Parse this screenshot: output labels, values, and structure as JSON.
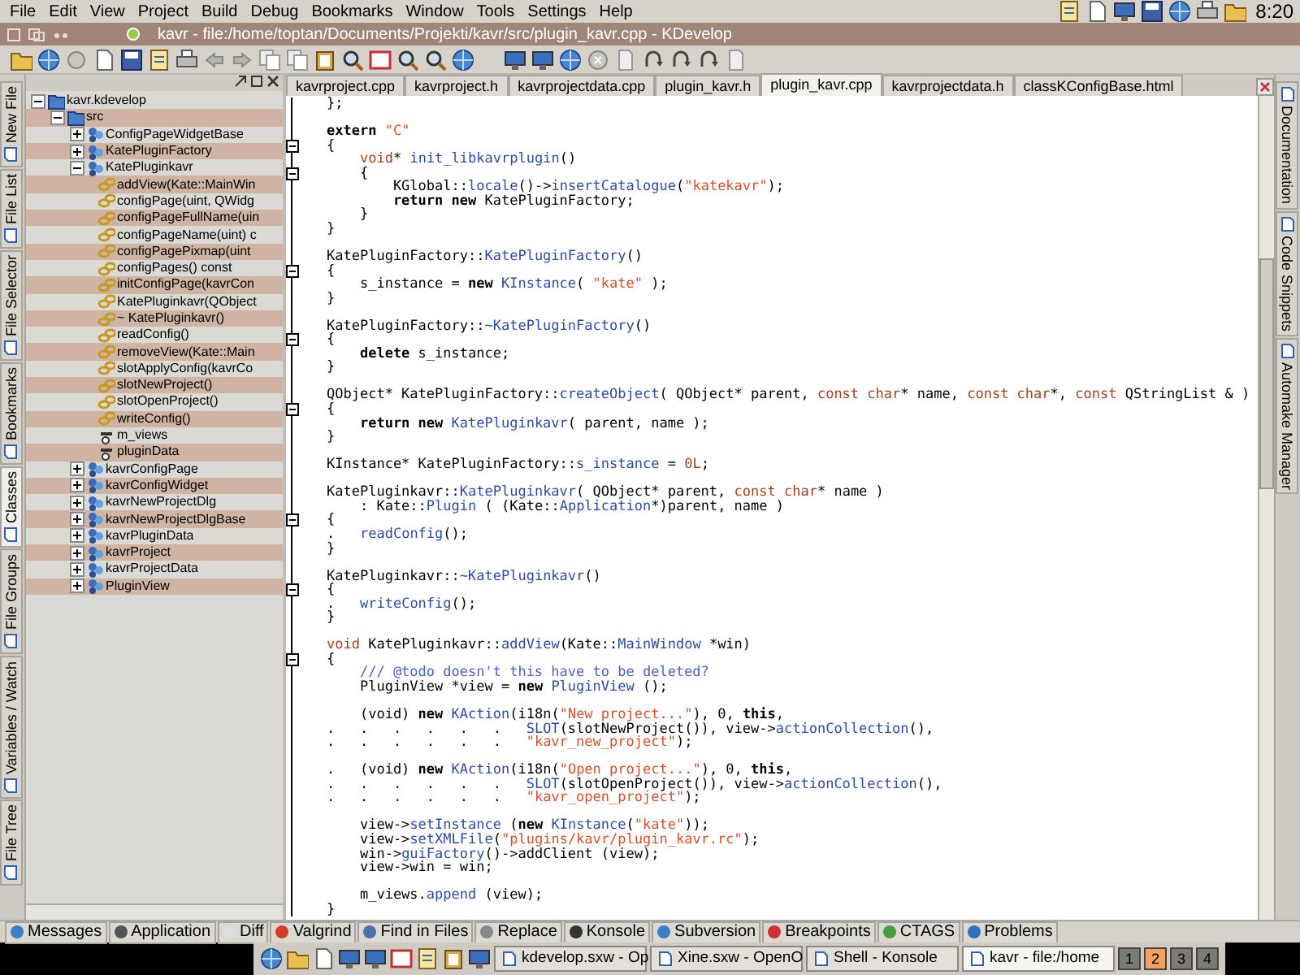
{
  "menu_bar": {
    "items": [
      "File",
      "Edit",
      "View",
      "Project",
      "Build",
      "Debug",
      "Bookmarks",
      "Window",
      "Tools",
      "Settings",
      "Help"
    ],
    "clock": "8:20"
  },
  "window": {
    "title": "kavr - file:/home/toptan/Documents/Projekti/kavr/src/plugin_kavr.cpp - KDevelop"
  },
  "left_tabs": [
    {
      "label": "New File",
      "selected": false
    },
    {
      "label": "File List",
      "selected": false
    },
    {
      "label": "File Selector",
      "selected": false
    },
    {
      "label": "Bookmarks",
      "selected": false
    },
    {
      "label": "Classes",
      "selected": true
    },
    {
      "label": "File Groups",
      "selected": false
    },
    {
      "label": "Variables / Watch",
      "selected": false
    },
    {
      "label": "File Tree",
      "selected": false
    }
  ],
  "class_tree": {
    "nodes": [
      {
        "label": "kavr.kdevelop",
        "kind": "project",
        "expanded": true,
        "children": [
          {
            "label": "src",
            "kind": "folder",
            "expanded": true,
            "children": [
              {
                "label": "ConfigPageWidgetBase",
                "kind": "class",
                "expanded": false
              },
              {
                "label": "KatePluginFactory",
                "kind": "class",
                "expanded": false
              },
              {
                "label": "KatePluginkavr",
                "kind": "class",
                "expanded": true,
                "children": [
                  {
                    "label": "addView(Kate::MainWin",
                    "kind": "method"
                  },
                  {
                    "label": "configPage(uint, QWidg",
                    "kind": "method"
                  },
                  {
                    "label": "configPageFullName(uin",
                    "kind": "method"
                  },
                  {
                    "label": "configPageName(uint) c",
                    "kind": "method"
                  },
                  {
                    "label": "configPagePixmap(uint",
                    "kind": "method"
                  },
                  {
                    "label": "configPages() const",
                    "kind": "method"
                  },
                  {
                    "label": "initConfigPage(kavrCon",
                    "kind": "method"
                  },
                  {
                    "label": "KatePluginkavr(QObject",
                    "kind": "method"
                  },
                  {
                    "label": "~ KatePluginkavr()",
                    "kind": "method"
                  },
                  {
                    "label": "readConfig()",
                    "kind": "method"
                  },
                  {
                    "label": "removeView(Kate::Main",
                    "kind": "method"
                  },
                  {
                    "label": "slotApplyConfig(kavrCo",
                    "kind": "method"
                  },
                  {
                    "label": "slotNewProject()",
                    "kind": "method"
                  },
                  {
                    "label": "slotOpenProject()",
                    "kind": "method"
                  },
                  {
                    "label": "writeConfig()",
                    "kind": "method"
                  },
                  {
                    "label": "m_views",
                    "kind": "attribute"
                  },
                  {
                    "label": "pluginData",
                    "kind": "attribute"
                  }
                ]
              },
              {
                "label": "kavrConfigPage",
                "kind": "class",
                "expanded": false
              },
              {
                "label": "kavrConfigWidget",
                "kind": "class",
                "expanded": false
              },
              {
                "label": "kavrNewProjectDlg",
                "kind": "class",
                "expanded": false
              },
              {
                "label": "kavrNewProjectDlgBase",
                "kind": "class",
                "expanded": false
              },
              {
                "label": "kavrPluginData",
                "kind": "class",
                "expanded": false
              },
              {
                "label": "kavrProject",
                "kind": "class",
                "expanded": false
              },
              {
                "label": "kavrProjectData",
                "kind": "class",
                "expanded": false
              },
              {
                "label": "PluginView",
                "kind": "class",
                "expanded": false
              }
            ]
          }
        ]
      }
    ]
  },
  "editor_tabs": [
    {
      "label": "kavrproject.cpp",
      "selected": false
    },
    {
      "label": "kavrproject.h",
      "selected": false
    },
    {
      "label": "kavrprojectdata.cpp",
      "selected": false
    },
    {
      "label": "plugin_kavr.h",
      "selected": false
    },
    {
      "label": "plugin_kavr.cpp",
      "selected": true
    },
    {
      "label": "kavrprojectdata.h",
      "selected": false
    },
    {
      "label": "classKConfigBase.html",
      "selected": false
    }
  ],
  "code": {
    "lines": [
      {
        "fold": false,
        "segments": [
          {
            "kind": "plain",
            "text": "};"
          }
        ]
      },
      {
        "fold": false
      },
      {
        "fold": false,
        "segments": [
          {
            "kind": "keyword",
            "text": "extern "
          },
          {
            "kind": "string",
            "text": "\"C\""
          }
        ]
      },
      {
        "fold": true,
        "segments": [
          {
            "kind": "plain",
            "text": "{"
          }
        ]
      },
      {
        "fold": false,
        "segments": [
          {
            "kind": "type",
            "text": "    void"
          },
          {
            "kind": "plain",
            "text": "* "
          },
          {
            "kind": "function",
            "text": "init_libkavrplugin"
          },
          {
            "kind": "plain",
            "text": "()"
          }
        ]
      },
      {
        "fold": true,
        "segments": [
          {
            "kind": "plain",
            "text": "    {"
          }
        ]
      },
      {
        "fold": false,
        "segments": [
          {
            "kind": "plain",
            "text": "        KGlobal::"
          },
          {
            "kind": "function",
            "text": "locale"
          },
          {
            "kind": "plain",
            "text": "()->"
          },
          {
            "kind": "function",
            "text": "insertCatalogue"
          },
          {
            "kind": "plain",
            "text": "("
          },
          {
            "kind": "string",
            "text": "\"katekavr\""
          },
          {
            "kind": "plain",
            "text": ");"
          }
        ]
      },
      {
        "fold": false,
        "segments": [
          {
            "kind": "keyword",
            "text": "        return new"
          },
          {
            "kind": "plain",
            "text": " KatePluginFactory;"
          }
        ]
      },
      {
        "fold": false,
        "segments": [
          {
            "kind": "plain",
            "text": "    }"
          }
        ]
      },
      {
        "fold": false,
        "segments": [
          {
            "kind": "plain",
            "text": "}"
          }
        ]
      },
      {
        "fold": false
      },
      {
        "fold": false,
        "segments": [
          {
            "kind": "plain",
            "text": "KatePluginFactory::"
          },
          {
            "kind": "function",
            "text": "KatePluginFactory"
          },
          {
            "kind": "plain",
            "text": "()"
          }
        ]
      },
      {
        "fold": true,
        "segments": [
          {
            "kind": "plain",
            "text": "{"
          }
        ]
      },
      {
        "fold": false,
        "segments": [
          {
            "kind": "plain",
            "text": "    s_instance = "
          },
          {
            "kind": "keyword",
            "text": "new "
          },
          {
            "kind": "function",
            "text": "KInstance"
          },
          {
            "kind": "plain",
            "text": "( "
          },
          {
            "kind": "string",
            "text": "\"kate\""
          },
          {
            "kind": "plain",
            "text": " );"
          }
        ]
      },
      {
        "fold": false,
        "segments": [
          {
            "kind": "plain",
            "text": "}"
          }
        ]
      },
      {
        "fold": false
      },
      {
        "fold": false,
        "segments": [
          {
            "kind": "plain",
            "text": "KatePluginFactory::"
          },
          {
            "kind": "function",
            "text": "~KatePluginFactory"
          },
          {
            "kind": "plain",
            "text": "()"
          }
        ]
      },
      {
        "fold": true,
        "segments": [
          {
            "kind": "plain",
            "text": "{"
          }
        ]
      },
      {
        "fold": false,
        "segments": [
          {
            "kind": "keyword",
            "text": "    delete"
          },
          {
            "kind": "plain",
            "text": " s_instance;"
          }
        ]
      },
      {
        "fold": false,
        "segments": [
          {
            "kind": "plain",
            "text": "}"
          }
        ]
      },
      {
        "fold": false
      },
      {
        "fold": false,
        "segments": [
          {
            "kind": "plain",
            "text": "QObject* KatePluginFactory::"
          },
          {
            "kind": "function",
            "text": "createObject"
          },
          {
            "kind": "plain",
            "text": "( QObject* parent, "
          },
          {
            "kind": "type",
            "text": "const char"
          },
          {
            "kind": "plain",
            "text": "* name, "
          },
          {
            "kind": "type",
            "text": "const char"
          },
          {
            "kind": "plain",
            "text": "*, "
          },
          {
            "kind": "type",
            "text": "const"
          },
          {
            "kind": "plain",
            "text": " QStringList & )"
          }
        ]
      },
      {
        "fold": true,
        "segments": [
          {
            "kind": "plain",
            "text": "{"
          }
        ]
      },
      {
        "fold": false,
        "segments": [
          {
            "kind": "keyword",
            "text": "    return new "
          },
          {
            "kind": "function",
            "text": "KatePluginkavr"
          },
          {
            "kind": "plain",
            "text": "( parent, name );"
          }
        ]
      },
      {
        "fold": false,
        "segments": [
          {
            "kind": "plain",
            "text": "}"
          }
        ]
      },
      {
        "fold": false
      },
      {
        "fold": false,
        "segments": [
          {
            "kind": "plain",
            "text": "KInstance* KatePluginFactory::"
          },
          {
            "kind": "function",
            "text": "s_instance"
          },
          {
            "kind": "plain",
            "text": " = "
          },
          {
            "kind": "type",
            "text": "0L"
          },
          {
            "kind": "plain",
            "text": ";"
          }
        ]
      },
      {
        "fold": false
      },
      {
        "fold": false,
        "segments": [
          {
            "kind": "plain",
            "text": "KatePluginkavr::"
          },
          {
            "kind": "function",
            "text": "KatePluginkavr"
          },
          {
            "kind": "plain",
            "text": "( QObject* parent, "
          },
          {
            "kind": "type",
            "text": "const char"
          },
          {
            "kind": "plain",
            "text": "* name )"
          }
        ]
      },
      {
        "fold": false,
        "segments": [
          {
            "kind": "plain",
            "text": "    : Kate::"
          },
          {
            "kind": "function",
            "text": "Plugin"
          },
          {
            "kind": "plain",
            "text": " ( (Kate::"
          },
          {
            "kind": "function",
            "text": "Application"
          },
          {
            "kind": "plain",
            "text": "*)parent, name )"
          }
        ]
      },
      {
        "fold": true,
        "segments": [
          {
            "kind": "plain",
            "text": "{"
          }
        ]
      },
      {
        "fold": false,
        "segments": [
          {
            "kind": "plain",
            "text": ".   "
          },
          {
            "kind": "function",
            "text": "readConfig"
          },
          {
            "kind": "plain",
            "text": "();"
          }
        ]
      },
      {
        "fold": false,
        "segments": [
          {
            "kind": "plain",
            "text": "}"
          }
        ]
      },
      {
        "fold": false
      },
      {
        "fold": false,
        "segments": [
          {
            "kind": "plain",
            "text": "KatePluginkavr::"
          },
          {
            "kind": "function",
            "text": "~KatePluginkavr"
          },
          {
            "kind": "plain",
            "text": "()"
          }
        ]
      },
      {
        "fold": true,
        "segments": [
          {
            "kind": "plain",
            "text": "{"
          }
        ]
      },
      {
        "fold": false,
        "segments": [
          {
            "kind": "plain",
            "text": ".   "
          },
          {
            "kind": "function",
            "text": "writeConfig"
          },
          {
            "kind": "plain",
            "text": "();"
          }
        ]
      },
      {
        "fold": false,
        "segments": [
          {
            "kind": "plain",
            "text": "}"
          }
        ]
      },
      {
        "fold": false
      },
      {
        "fold": false,
        "segments": [
          {
            "kind": "type",
            "text": "void"
          },
          {
            "kind": "plain",
            "text": " KatePluginkavr::"
          },
          {
            "kind": "function",
            "text": "addView"
          },
          {
            "kind": "plain",
            "text": "(Kate::"
          },
          {
            "kind": "function",
            "text": "MainWindow"
          },
          {
            "kind": "plain",
            "text": " *win)"
          }
        ]
      },
      {
        "fold": true,
        "segments": [
          {
            "kind": "plain",
            "text": "{"
          }
        ]
      },
      {
        "fold": false,
        "segments": [
          {
            "kind": "comment",
            "text": "    /// @todo doesn't this have to be deleted?"
          }
        ]
      },
      {
        "fold": false,
        "segments": [
          {
            "kind": "plain",
            "text": "    PluginView *view = "
          },
          {
            "kind": "keyword",
            "text": "new "
          },
          {
            "kind": "function",
            "text": "PluginView"
          },
          {
            "kind": "plain",
            "text": " ();"
          }
        ]
      },
      {
        "fold": false
      },
      {
        "fold": false,
        "segments": [
          {
            "kind": "plain",
            "text": "    (void) "
          },
          {
            "kind": "keyword",
            "text": "new "
          },
          {
            "kind": "function",
            "text": "KAction"
          },
          {
            "kind": "plain",
            "text": "(i18n("
          },
          {
            "kind": "string",
            "text": "\"New project...\""
          },
          {
            "kind": "plain",
            "text": "), 0, "
          },
          {
            "kind": "keyword",
            "text": "this"
          },
          {
            "kind": "plain",
            "text": ","
          }
        ]
      },
      {
        "fold": false,
        "segments": [
          {
            "kind": "plain",
            "text": ".   .   .   .   .   .   "
          },
          {
            "kind": "function",
            "text": "SLOT"
          },
          {
            "kind": "plain",
            "text": "(slotNewProject()), view->"
          },
          {
            "kind": "function",
            "text": "actionCollection"
          },
          {
            "kind": "plain",
            "text": "(),"
          }
        ]
      },
      {
        "fold": false,
        "segments": [
          {
            "kind": "plain",
            "text": ".   .   .   .   .   .   "
          },
          {
            "kind": "string",
            "text": "\"kavr_new_project\""
          },
          {
            "kind": "plain",
            "text": ");"
          }
        ]
      },
      {
        "fold": false
      },
      {
        "fold": false,
        "segments": [
          {
            "kind": "plain",
            "text": ".   (void) "
          },
          {
            "kind": "keyword",
            "text": "new "
          },
          {
            "kind": "function",
            "text": "KAction"
          },
          {
            "kind": "plain",
            "text": "(i18n("
          },
          {
            "kind": "string",
            "text": "\"Open project...\""
          },
          {
            "kind": "plain",
            "text": "), 0, "
          },
          {
            "kind": "keyword",
            "text": "this"
          },
          {
            "kind": "plain",
            "text": ","
          }
        ]
      },
      {
        "fold": false,
        "segments": [
          {
            "kind": "plain",
            "text": ".   .   .   .   .   .   "
          },
          {
            "kind": "function",
            "text": "SLOT"
          },
          {
            "kind": "plain",
            "text": "(slotOpenProject()), view->"
          },
          {
            "kind": "function",
            "text": "actionCollection"
          },
          {
            "kind": "plain",
            "text": "(),"
          }
        ]
      },
      {
        "fold": false,
        "segments": [
          {
            "kind": "plain",
            "text": ".   .   .   .   .   .   "
          },
          {
            "kind": "string",
            "text": "\"kavr_open_project\""
          },
          {
            "kind": "plain",
            "text": ");"
          }
        ]
      },
      {
        "fold": false
      },
      {
        "fold": false,
        "segments": [
          {
            "kind": "plain",
            "text": "    view->"
          },
          {
            "kind": "function",
            "text": "setInstance"
          },
          {
            "kind": "plain",
            "text": " ("
          },
          {
            "kind": "keyword",
            "text": "new "
          },
          {
            "kind": "function",
            "text": "KInstance"
          },
          {
            "kind": "plain",
            "text": "("
          },
          {
            "kind": "string",
            "text": "\"kate\""
          },
          {
            "kind": "plain",
            "text": "));"
          }
        ]
      },
      {
        "fold": false,
        "segments": [
          {
            "kind": "plain",
            "text": "    view->"
          },
          {
            "kind": "function",
            "text": "setXMLFile"
          },
          {
            "kind": "plain",
            "text": "("
          },
          {
            "kind": "string",
            "text": "\"plugins/kavr/plugin_kavr.rc\""
          },
          {
            "kind": "plain",
            "text": ");"
          }
        ]
      },
      {
        "fold": false,
        "segments": [
          {
            "kind": "plain",
            "text": "    win->"
          },
          {
            "kind": "function",
            "text": "guiFactory"
          },
          {
            "kind": "plain",
            "text": "()->addClient (view);"
          }
        ]
      },
      {
        "fold": false,
        "segments": [
          {
            "kind": "plain",
            "text": "    view->win = win;"
          }
        ]
      },
      {
        "fold": false
      },
      {
        "fold": false,
        "segments": [
          {
            "kind": "plain",
            "text": "    m_views."
          },
          {
            "kind": "function",
            "text": "append"
          },
          {
            "kind": "plain",
            "text": " (view);"
          }
        ]
      },
      {
        "fold": false,
        "segments": [
          {
            "kind": "plain",
            "text": "}"
          }
        ]
      }
    ]
  },
  "right_tabs": [
    {
      "label": "Documentation",
      "selected": false
    },
    {
      "label": "Code Snippets",
      "selected": false
    },
    {
      "label": "Automake Manager",
      "selected": false
    }
  ],
  "bottom_tabs": [
    {
      "label": "Messages",
      "selected": false
    },
    {
      "label": "Application",
      "selected": false
    },
    {
      "label": "Diff",
      "selected": false
    },
    {
      "label": "Valgrind",
      "selected": false
    },
    {
      "label": "Find in Files",
      "selected": false
    },
    {
      "label": "Replace",
      "selected": false
    },
    {
      "label": "Konsole",
      "selected": false
    },
    {
      "label": "Subversion",
      "selected": false
    },
    {
      "label": "Breakpoints",
      "selected": false
    },
    {
      "label": "CTAGS",
      "selected": false
    },
    {
      "label": "Problems",
      "selected": false
    }
  ],
  "taskbar": {
    "tasks": [
      {
        "label": "kdevelop.sxw - Op",
        "selected": false
      },
      {
        "label": "Xine.sxw - OpenO",
        "selected": false
      },
      {
        "label": "Shell - Konsole",
        "selected": false
      },
      {
        "label": "kavr - file:/home",
        "selected": true
      }
    ],
    "desktops": [
      {
        "label": "1",
        "selected": false
      },
      {
        "label": "2",
        "selected": true
      },
      {
        "label": "3",
        "selected": false
      },
      {
        "label": "4",
        "selected": false
      }
    ]
  }
}
